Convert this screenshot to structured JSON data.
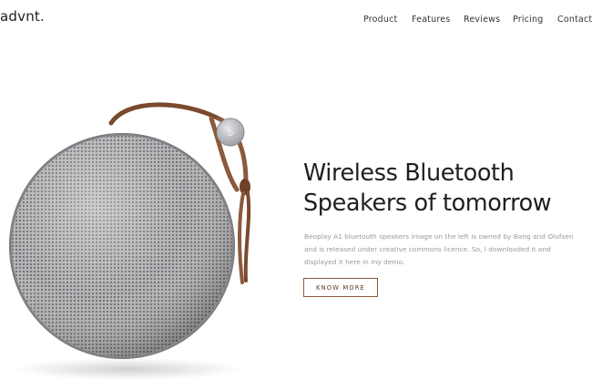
{
  "brand": {
    "logo_text": "advnt."
  },
  "nav": {
    "items": [
      {
        "label": "Product"
      },
      {
        "label": "Features"
      },
      {
        "label": "Reviews"
      },
      {
        "label": "Pricing"
      },
      {
        "label": "Contact"
      }
    ]
  },
  "hero": {
    "headline_line1": "Wireless Bluetooth",
    "headline_line2": "Speakers of tomorrow",
    "description_lines": [
      "Beoplay A1 bluetooth speakers image on the left is owned by Bang and Olufsen",
      "and is released under creative commons licence. So, I downloaded it and",
      "displayed it here in my demo."
    ],
    "cta_label": "KNOW MORE"
  },
  "product_image": {
    "icon": "speaker-image",
    "grille_color": "#9d9d9f",
    "strap_color": "#8a5a3c"
  },
  "colors": {
    "accent": "#8a5a3c",
    "heading": "#1f1f1f",
    "muted": "#9a9a9a"
  }
}
